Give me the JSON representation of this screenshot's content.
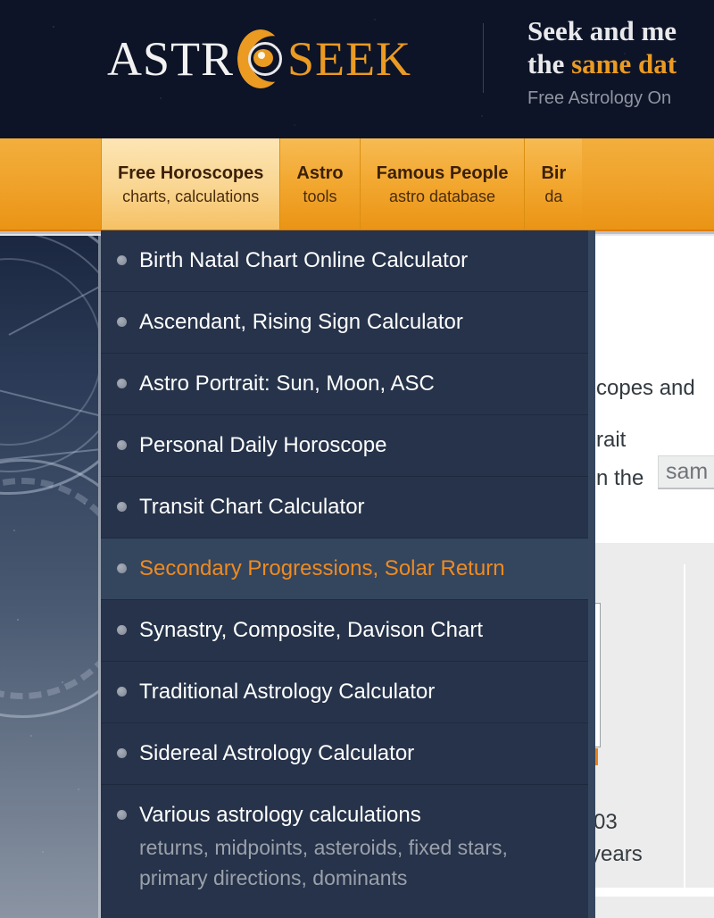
{
  "header": {
    "logo": {
      "part1": "ASTR",
      "part2": "SEEK",
      "moon_icon": "crescent-moon-eye-icon"
    },
    "tagline_line1": "Seek and me",
    "tagline_line2_plain": "the ",
    "tagline_line2_highlight": "same dat",
    "tagline_sub": "Free Astrology On",
    "accent_color": "#eb9a22",
    "background_color": "#0d1427"
  },
  "nav": {
    "tabs": [
      {
        "title": "Free Horoscopes",
        "subtitle": "charts, calculations",
        "active": true
      },
      {
        "title": "Astro",
        "subtitle": "tools",
        "active": false
      },
      {
        "title": "Famous People",
        "subtitle": "astro database",
        "active": false
      },
      {
        "title": "Bir",
        "subtitle": "da",
        "active": false
      }
    ],
    "background_color": "#f0a42d",
    "active_color": "#f9d590"
  },
  "dropdown": {
    "background_color": "#26334a",
    "hover_color": "#34455e",
    "hover_text_color": "#ef8b1f",
    "items": [
      {
        "label": "Birth Natal Chart Online Calculator",
        "subtitle": "",
        "hover": false
      },
      {
        "label": "Ascendant, Rising Sign Calculator",
        "subtitle": "",
        "hover": false
      },
      {
        "label": "Astro Portrait: Sun, Moon, ASC",
        "subtitle": "",
        "hover": false
      },
      {
        "label": "Personal Daily Horoscope",
        "subtitle": "",
        "hover": false
      },
      {
        "label": "Transit Chart Calculator",
        "subtitle": "",
        "hover": false
      },
      {
        "label": "Secondary Progressions, Solar Return",
        "subtitle": "",
        "hover": true
      },
      {
        "label": "Synastry, Composite, Davison Chart",
        "subtitle": "",
        "hover": false
      },
      {
        "label": "Traditional Astrology Calculator",
        "subtitle": "",
        "hover": false
      },
      {
        "label": "Sidereal Astrology Calculator",
        "subtitle": "",
        "hover": false
      },
      {
        "label": "Various astrology calculations",
        "subtitle": "returns, midpoints, asteroids, fixed stars, primary directions, dominants",
        "hover": false
      }
    ]
  },
  "background_page": {
    "text_fragment_1": "copes and ",
    "text_fragment_2": "rait",
    "text_fragment_3": "n the",
    "input_value": "sam",
    "number_fragment": "03",
    "years_fragment": "years"
  },
  "sidebar": {
    "art": "zodiac-wheel-illustration"
  }
}
